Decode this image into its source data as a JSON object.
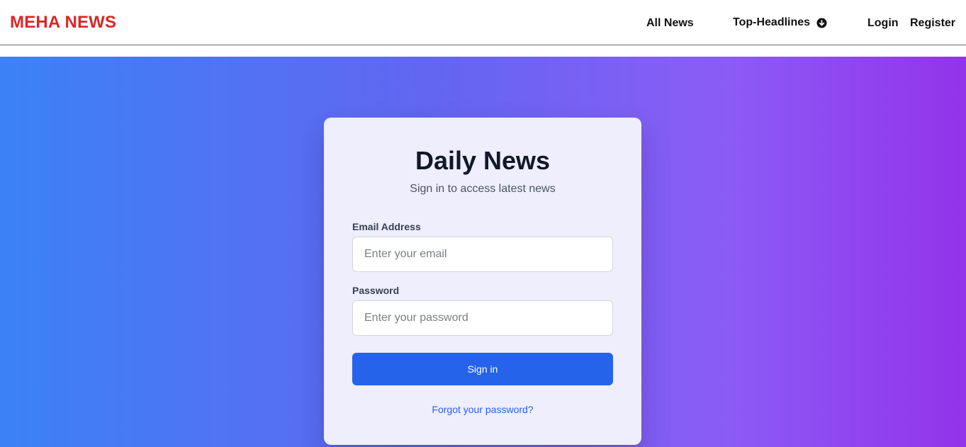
{
  "navbar": {
    "logo": "MEHA NEWS",
    "links": {
      "all_news": "All News",
      "top_headlines": "Top-Headlines",
      "login": "Login",
      "register": "Register"
    }
  },
  "login_card": {
    "title": "Daily News",
    "subtitle": "Sign in to access latest news",
    "email": {
      "label": "Email Address",
      "placeholder": "Enter your email",
      "value": ""
    },
    "password": {
      "label": "Password",
      "placeholder": "Enter your password",
      "value": ""
    },
    "submit_label": "Sign in",
    "forgot_label": "Forgot your password?"
  },
  "colors": {
    "brand_red": "#dc2626",
    "primary_blue": "#2563eb",
    "gradient_start": "#3b82f6",
    "gradient_end": "#9333ea",
    "card_bg": "#eeeefc"
  },
  "icons": {
    "top_headlines_dropdown": "arrow-down-circle-icon"
  }
}
